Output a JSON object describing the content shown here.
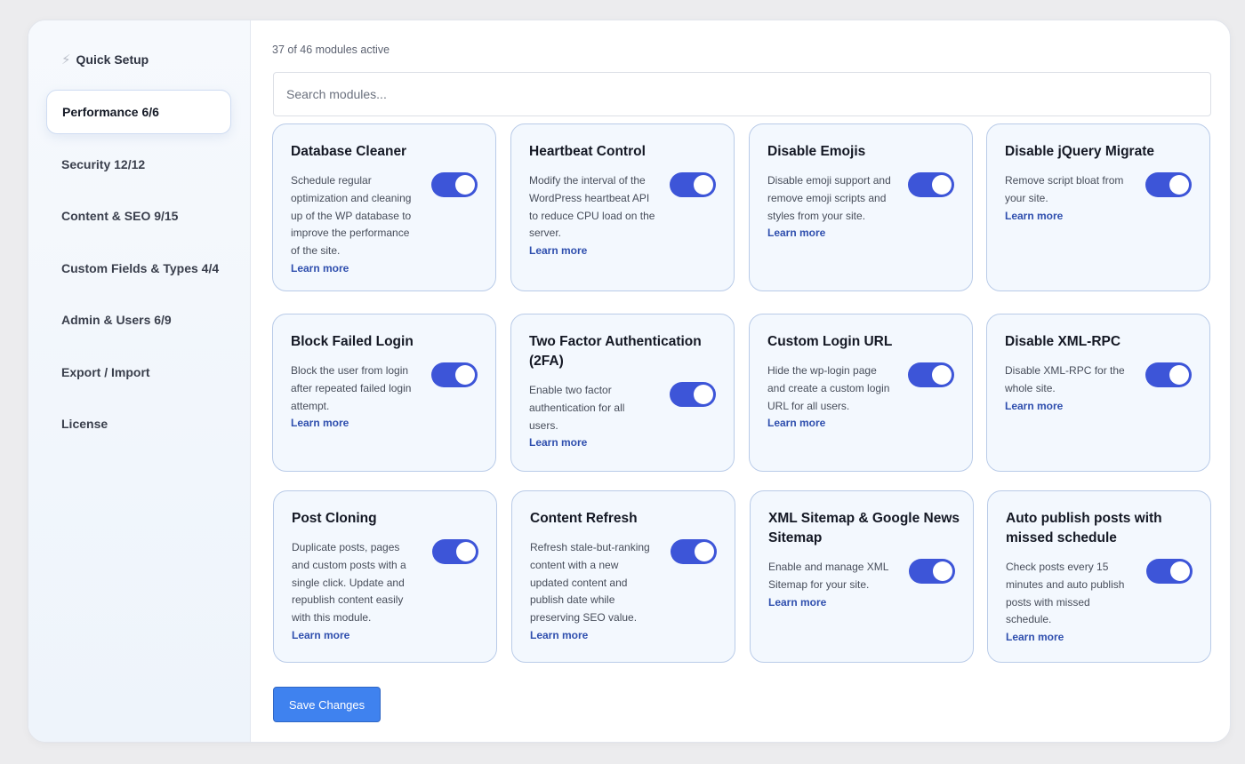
{
  "sidebar": {
    "quick_setup": "Quick Setup",
    "items": [
      {
        "label": "Performance 6/6",
        "active": true
      },
      {
        "label": "Security 12/12"
      },
      {
        "label": "Content & SEO 9/15"
      },
      {
        "label": "Custom Fields & Types 4/4"
      },
      {
        "label": "Admin & Users 6/9"
      },
      {
        "label": "Export / Import"
      },
      {
        "label": "License"
      }
    ]
  },
  "main": {
    "status": "37 of 46 modules active",
    "search_placeholder": "Search modules...",
    "learn_more": "Learn more",
    "save_label": "Save Changes",
    "modules": [
      {
        "title": "Database Cleaner",
        "desc": "Schedule regular optimization and cleaning up of the WP database to improve the performance of the site.",
        "enabled": true
      },
      {
        "title": "Heartbeat Control",
        "desc": "Modify the interval of the WordPress heartbeat API to reduce CPU load on the server.",
        "enabled": true
      },
      {
        "title": "Disable Emojis",
        "desc": "Disable emoji support and remove emoji scripts and styles from your site.",
        "enabled": true
      },
      {
        "title": "Disable jQuery Migrate",
        "desc": "Remove script bloat from your site.",
        "enabled": true
      },
      {
        "title": "Block Failed Login",
        "desc": "Block the user from login after repeated failed login attempt.",
        "enabled": true
      },
      {
        "title": "Two Factor Authentication (2FA)",
        "desc": "Enable two factor authentication for all users.",
        "enabled": true
      },
      {
        "title": "Custom Login URL",
        "desc": "Hide the wp-login page and create a custom login URL for all users.",
        "enabled": true
      },
      {
        "title": "Disable XML-RPC",
        "desc": "Disable XML-RPC for the whole site.",
        "enabled": true
      },
      {
        "title": "Post Cloning",
        "desc": "Duplicate posts, pages and custom posts with a single click. Update and republish content easily with this module.",
        "enabled": true
      },
      {
        "title": "Content Refresh",
        "desc": "Refresh stale-but-ranking content with a new updated content and publish date while preserving SEO value.",
        "enabled": true
      },
      {
        "title": "XML Sitemap & Google News Sitemap",
        "desc": "Enable and manage XML Sitemap for your site.",
        "enabled": true
      },
      {
        "title": "Auto publish posts with missed schedule",
        "desc": "Check posts every 15 minutes and auto publish posts with missed schedule.",
        "enabled": true
      }
    ]
  },
  "colors": {
    "accent": "#3d55d8",
    "button": "#3f82ef",
    "link": "#2f4fae",
    "card_bg": "#f3f8fe",
    "card_border": "#b9cbe8"
  }
}
